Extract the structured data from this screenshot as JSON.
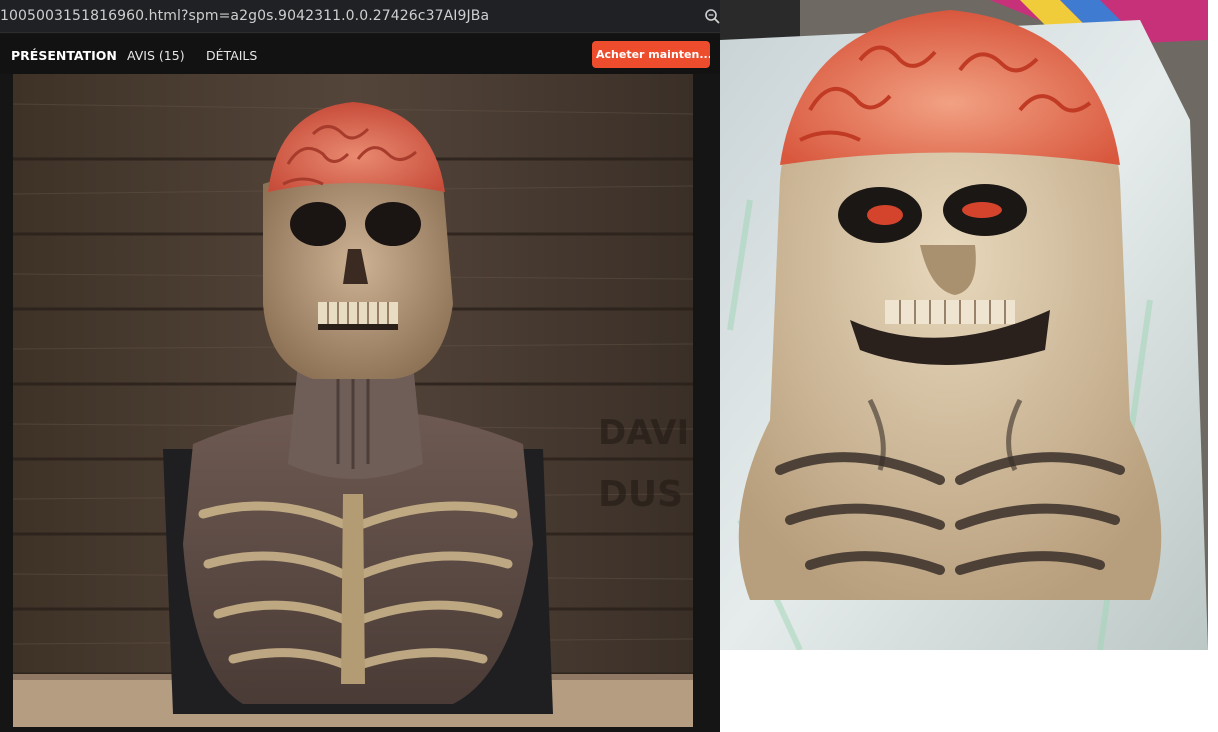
{
  "browser": {
    "url_fragment": "1005003151816960.html?spm=a2g0s.9042311.0.0.27426c37AI9JBa",
    "zoom_icon": "zoom-icon"
  },
  "product_nav": {
    "tabs": [
      {
        "label": "PRÉSENTATION",
        "active": true
      },
      {
        "label": "AVIS",
        "count": "(15)",
        "active": false
      },
      {
        "label": "DÉTAILS",
        "active": false
      }
    ],
    "buy_button_label": "Acheter mainten...",
    "accent_color": "#ee4d2d"
  },
  "images": {
    "main_product": {
      "subject": "skull-bust-mask-product-photo",
      "background_text_lines": [
        "DAVI",
        "DUS"
      ]
    },
    "review_photo": {
      "subject": "skull-mask-customer-photo"
    }
  }
}
